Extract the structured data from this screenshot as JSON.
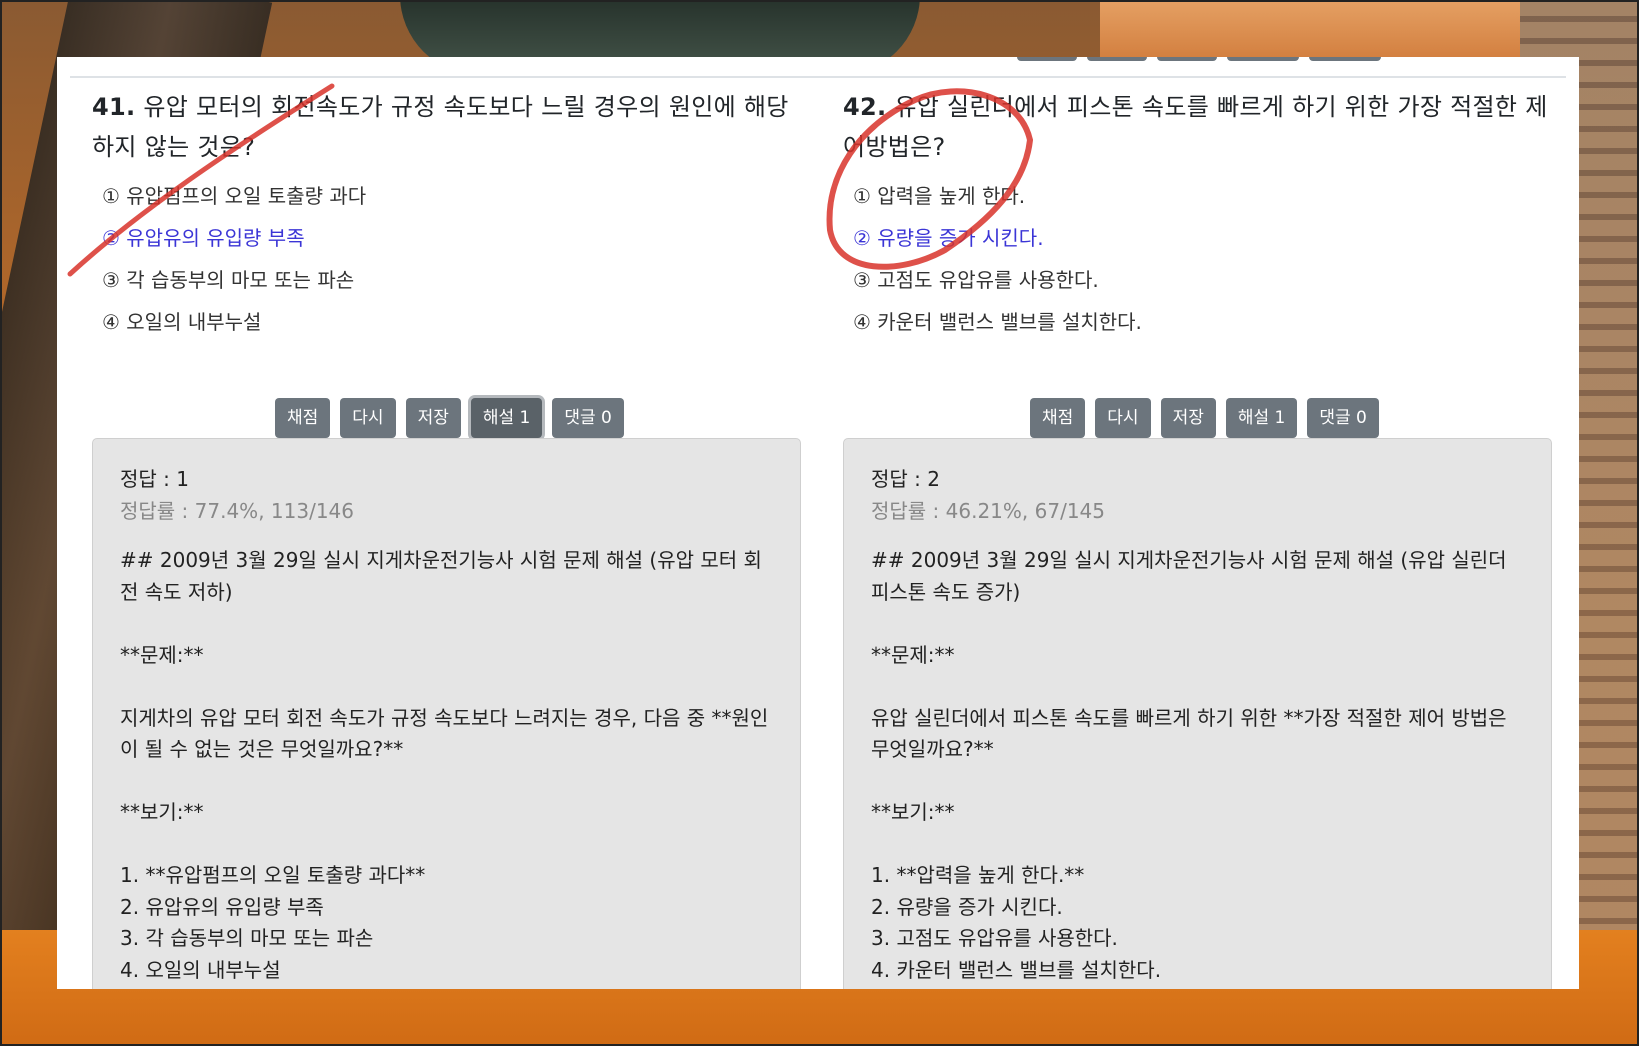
{
  "q41": {
    "number": "41.",
    "title": " 유압 모터의 회전속도가 규정 속도보다 느릴 경우의 원인에 해당하지 않는 것은?",
    "options": [
      "① 유압펌프의 오일 토출량 과다",
      "② 유압유의 유입량 부족",
      "③ 각 습동부의 마모 또는 파손",
      "④ 오일의 내부누설"
    ],
    "buttons": {
      "grade": "채점",
      "retry": "다시",
      "save": "저장",
      "explain": "해설 1",
      "comments": "댓글 0"
    },
    "answer": "정답 : 1",
    "rate": "정답률 : 77.4%, 113/146",
    "body": "## 2009년 3월 29일 실시 지게차운전기능사 시험 문제 해설 (유압 모터 회전 속도 저하)\n\n**문제:**\n\n지게차의 유압 모터 회전 속도가 규정 속도보다 느려지는 경우, 다음 중 **원인이 될 수 없는 것은 무엇일까요?**\n\n**보기:**\n\n1. **유압펌프의 오일 토출량 과다**\n2. 유압유의 유입량 부족\n3. 각 습동부의 마모 또는 파손\n4. 오일의 내부누설"
  },
  "q42": {
    "number": "42.",
    "title": " 유압 실린더에서 피스톤 속도를 빠르게 하기 위한 가장 적절한 제어방법은?",
    "options": [
      "① 압력을 높게 한다.",
      "② 유량을 증가 시킨다.",
      "③ 고점도 유압유를 사용한다.",
      "④ 카운터 밸런스 밸브를 설치한다."
    ],
    "buttons": {
      "grade": "채점",
      "retry": "다시",
      "save": "저장",
      "explain": "해설 1",
      "comments": "댓글 0"
    },
    "answer": "정답 : 2",
    "rate": "정답률 : 46.21%, 67/145",
    "body": "## 2009년 3월 29일 실시 지게차운전기능사 시험 문제 해설 (유압 실린더 피스톤 속도 증가)\n\n**문제:**\n\n유압 실린더에서 피스톤 속도를 빠르게 하기 위한 **가장 적절한 제어 방법은 무엇일까요?**\n\n**보기:**\n\n1. **압력을 높게 한다.**\n2. 유량을 증가 시킨다.\n3. 고점도 유압유를 사용한다.\n4. 카운터 밸런스 밸브를 설치한다."
  },
  "colors": {
    "correct_option": "#3b35d6",
    "button": "#6c757d",
    "annotation": "#d8322a"
  }
}
